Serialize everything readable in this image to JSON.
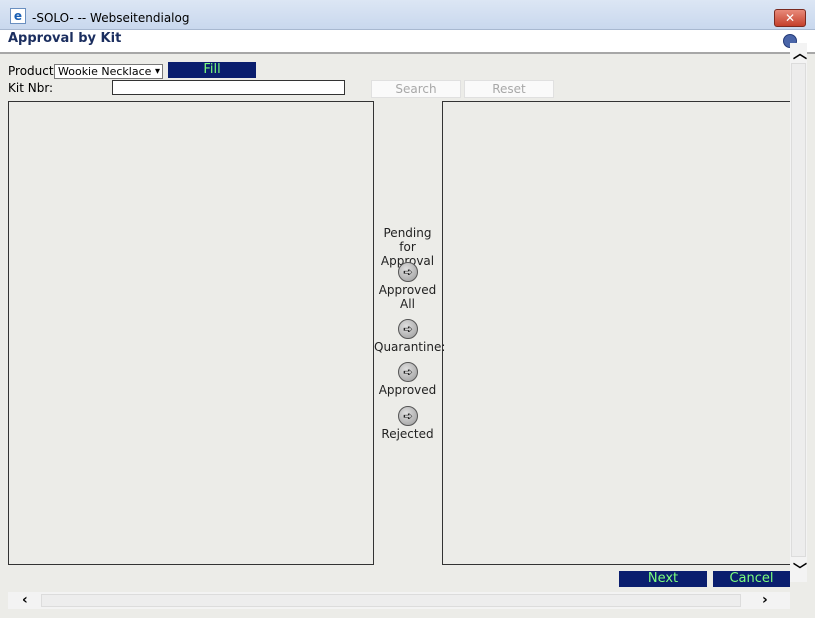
{
  "window": {
    "title": "-SOLO- -- Webseitendialog",
    "close_label": "✕",
    "app_icon": "ie-icon"
  },
  "page": {
    "title": "Approval by Kit"
  },
  "form": {
    "product_label": "Product",
    "product_value": "Wookie Necklace",
    "fill_label": "Fill",
    "kitnbr_label": "Kit Nbr:",
    "kitnbr_value": "",
    "search_label": "Search",
    "reset_label": "Reset"
  },
  "middle": {
    "pending_label": "Pending for Approval",
    "approved_all_label": "Approved All",
    "quarantine_label": "Quarantine:",
    "approved_label": "Approved",
    "rejected_label": "Rejected"
  },
  "footer": {
    "next_label": "Next",
    "cancel_label": "Cancel"
  },
  "colors": {
    "navy": "#0a1e6e",
    "button_text": "#7cff7c",
    "title_text": "#1b2e5f"
  }
}
